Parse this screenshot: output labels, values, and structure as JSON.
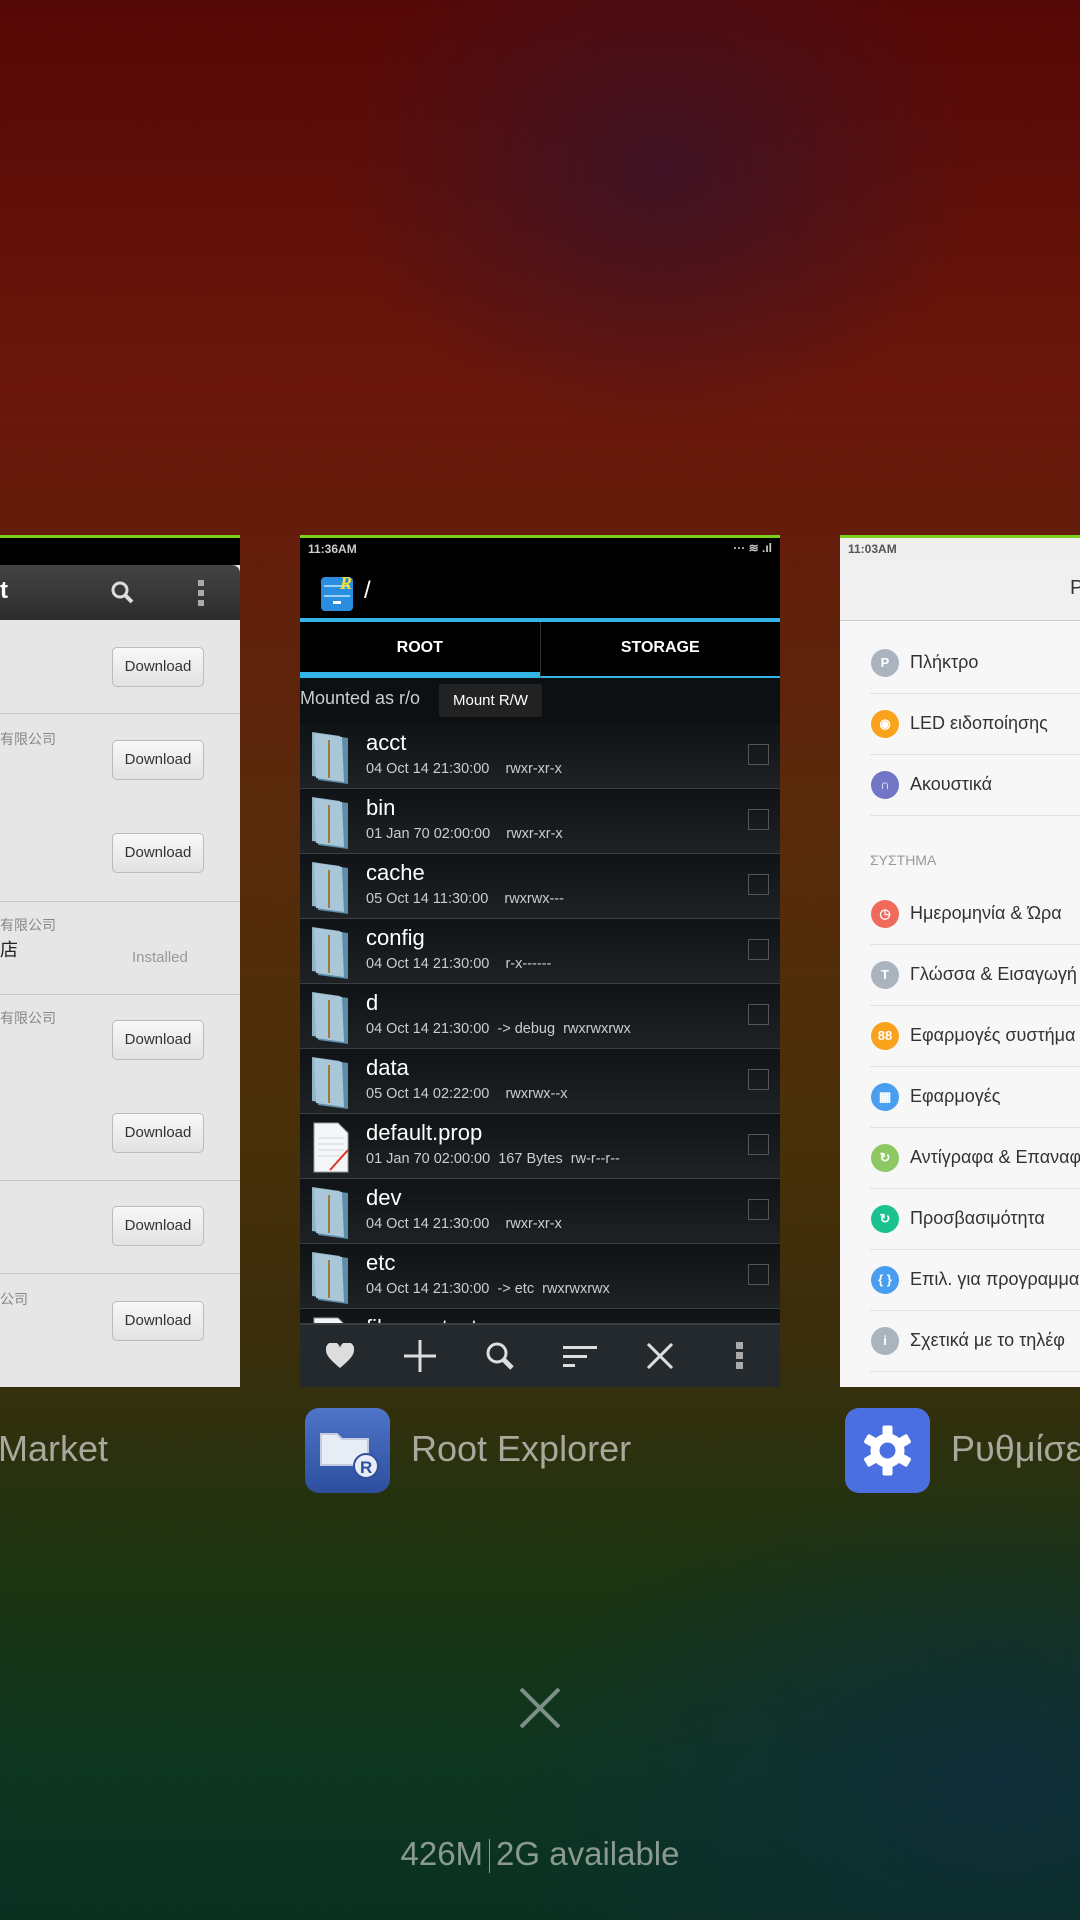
{
  "left_card": {
    "title_fragment": "t",
    "rows": [
      {
        "subtitle": "",
        "title": "",
        "action": "Download"
      },
      {
        "subtitle": "有限公司",
        "title": "",
        "action": "Download"
      },
      {
        "subtitle": "",
        "title": "",
        "action": "Download"
      },
      {
        "subtitle": "有限公司",
        "title": "店",
        "action": "Installed"
      },
      {
        "subtitle": "有限公司",
        "title": "",
        "action": "Download"
      },
      {
        "subtitle": "",
        "title": "",
        "action": "Download"
      },
      {
        "subtitle": "",
        "title": "",
        "action": "Download"
      },
      {
        "subtitle": "公司",
        "title": "",
        "action": "Download"
      }
    ],
    "app_label": "Market"
  },
  "center_card": {
    "status_time": "11:36AM",
    "path": "/",
    "tabs": [
      {
        "label": "ROOT",
        "active": true
      },
      {
        "label": "STORAGE",
        "active": false
      }
    ],
    "mount_status": "Mounted as r/o",
    "mount_button": "Mount R/W",
    "files": [
      {
        "name": "acct",
        "meta": "04 Oct 14 21:30:00    rwxr-xr-x",
        "type": "folder"
      },
      {
        "name": "bin",
        "meta": "01 Jan 70 02:00:00    rwxr-xr-x",
        "type": "folder"
      },
      {
        "name": "cache",
        "meta": "05 Oct 14 11:30:00    rwxrwx---",
        "type": "folder"
      },
      {
        "name": "config",
        "meta": "04 Oct 14 21:30:00    r-x------",
        "type": "folder"
      },
      {
        "name": "d",
        "meta": "04 Oct 14 21:30:00  -> debug  rwxrwxrwx",
        "type": "folder"
      },
      {
        "name": "data",
        "meta": "05 Oct 14 02:22:00    rwxrwx--x",
        "type": "folder"
      },
      {
        "name": "default.prop",
        "meta": "01 Jan 70 02:00:00  167 Bytes  rw-r--r--",
        "type": "file"
      },
      {
        "name": "dev",
        "meta": "04 Oct 14 21:30:00    rwxr-xr-x",
        "type": "folder"
      },
      {
        "name": "etc",
        "meta": "04 Oct 14 21:30:00  -> etc  rwxrwxrwx",
        "type": "folder"
      },
      {
        "name": "file_contexts",
        "meta": "",
        "type": "file"
      }
    ],
    "toolbar": [
      "heart-icon",
      "plus-icon",
      "search-icon",
      "sort-icon",
      "close-icon",
      "overflow-menu-icon"
    ],
    "app_label": "Root Explorer",
    "accent": "#33b5e5"
  },
  "right_card": {
    "status_time": "11:03AM",
    "title": "Ρυθμ",
    "items_top": [
      {
        "label": "Πλήκτρο",
        "color": "#a9b4bf",
        "glyph": "P"
      },
      {
        "label": "LED ειδοποίησης",
        "color": "#f9a21c",
        "glyph": "◉"
      },
      {
        "label": "Ακουστικά",
        "color": "#7176c6",
        "glyph": "∩"
      }
    ],
    "section": "ΣΥΣΤΗΜΑ",
    "items_system": [
      {
        "label": "Ημερομηνία & Ώρα",
        "color": "#ef6a5a",
        "glyph": "◷"
      },
      {
        "label": "Γλώσσα & Εισαγωγή",
        "color": "#a9b4bf",
        "glyph": "T"
      },
      {
        "label": "Εφαρμογές συστήμα",
        "color": "#f9a21c",
        "glyph": "88"
      },
      {
        "label": "Εφαρμογές",
        "color": "#4a9ef0",
        "glyph": "▦"
      },
      {
        "label": "Αντίγραφα & Επαναφ",
        "color": "#8dc862",
        "glyph": "↻"
      },
      {
        "label": "Προσβασιμότητα",
        "color": "#19c28e",
        "glyph": "↻"
      },
      {
        "label": "Επιλ. για προγραμμα",
        "color": "#4a9ef0",
        "glyph": "{ }"
      },
      {
        "label": "Σχετικά με το τηλέφ",
        "color": "#a9b4bf",
        "glyph": "i"
      }
    ],
    "app_label": "Ρυθμίσε"
  },
  "memory": {
    "used": "426M",
    "available": "2G available"
  }
}
